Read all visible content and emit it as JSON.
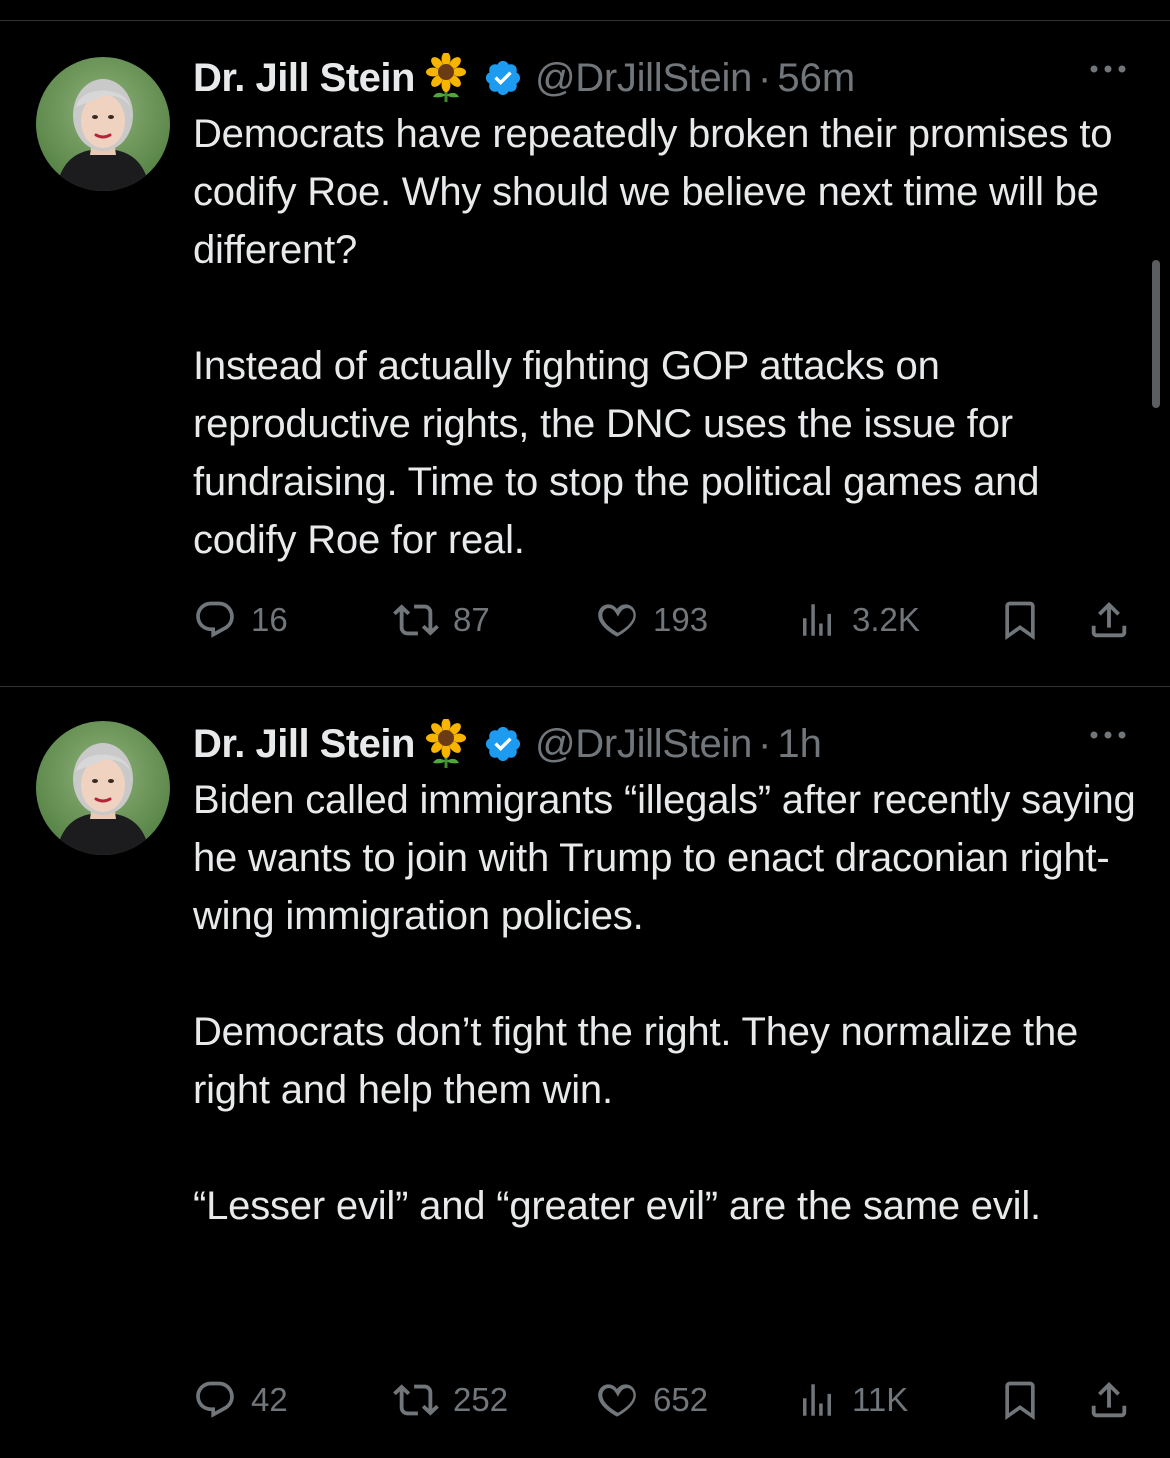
{
  "tweets": [
    {
      "display_name": "Dr. Jill Stein",
      "name_emoji": "sunflower-icon",
      "verified_color": "#1d9bf0",
      "handle": "@DrJillStein",
      "separator": "·",
      "time": "56m",
      "paragraphs": [
        "Democrats have repeatedly broken their promises to codify Roe. Why should we believe next time will be different?",
        "Instead of actually fighting GOP attacks on reproductive rights, the DNC uses the issue for fundraising. Time to stop the political games and codify Roe for real."
      ],
      "replies": "16",
      "reposts": "87",
      "likes": "193",
      "views": "3.2K"
    },
    {
      "display_name": "Dr. Jill Stein",
      "name_emoji": "sunflower-icon",
      "verified_color": "#1d9bf0",
      "handle": "@DrJillStein",
      "separator": "·",
      "time": "1h",
      "paragraphs": [
        "Biden called immigrants “illegals” after recently saying he wants to join with Trump to enact draconian right-wing immigration policies.",
        "Democrats don’t fight the right. They normalize the right and help them win.",
        "“Lesser evil” and “greater evil” are the same evil."
      ],
      "replies": "42",
      "reposts": "252",
      "likes": "652",
      "views": "11K"
    }
  ],
  "icons": {
    "reply": "reply-icon",
    "repost": "repost-icon",
    "like": "heart-icon",
    "views": "views-icon",
    "bookmark": "bookmark-icon",
    "share": "share-icon",
    "more": "more-icon"
  },
  "colors": {
    "background": "#000000",
    "text": "#e7e9ea",
    "secondary_text": "#71767b",
    "divider": "#2f3336",
    "verified": "#1d9bf0"
  }
}
